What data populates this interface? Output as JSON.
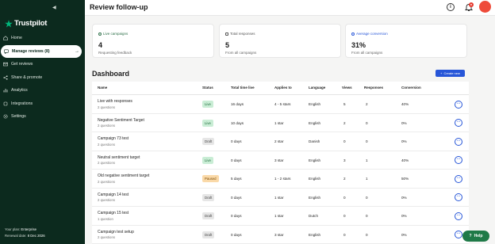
{
  "brand": {
    "name": "Trustpilot"
  },
  "sidebar": {
    "items": [
      {
        "label": "Home",
        "icon": "home-icon"
      },
      {
        "label": "Manage reviews (8)",
        "icon": "message-icon",
        "active": true
      },
      {
        "label": "Get reviews",
        "icon": "mail-icon"
      },
      {
        "label": "Share & promote",
        "icon": "share-icon"
      },
      {
        "label": "Analytics",
        "icon": "chart-icon"
      },
      {
        "label": "Integrations",
        "icon": "plug-icon"
      },
      {
        "label": "Settings",
        "icon": "gear-icon"
      }
    ],
    "footer": {
      "plan_label": "Your plan:",
      "plan_value": "Enterprise",
      "renewal_label": "Renewal date:",
      "renewal_value": "8 Dec 2026"
    }
  },
  "header": {
    "title": "Review follow-up"
  },
  "stats": [
    {
      "label": "Live campaigns",
      "value": "4",
      "sub": "Requesting feedback"
    },
    {
      "label": "Total responses",
      "value": "5",
      "sub": "From all campaigns"
    },
    {
      "label": "Average conversion",
      "value": "31%",
      "sub": "From all campaigns"
    }
  ],
  "dashboard": {
    "title": "Dashboard",
    "create_label": "Create new",
    "columns": [
      "Name",
      "Status",
      "Total time live",
      "Applies to",
      "Language",
      "Views",
      "Responses",
      "Conversion"
    ],
    "rows": [
      {
        "name": "Live with responses",
        "sub": "2 questions",
        "status": "Live",
        "time": "16 days",
        "applies": "4 - 5 stars",
        "language": "English",
        "views": "5",
        "responses": "2",
        "conversion": "40%"
      },
      {
        "name": "Negative Sentiment Target",
        "sub": "2 questions",
        "status": "Live",
        "time": "10 days",
        "applies": "1 star",
        "language": "English",
        "views": "2",
        "responses": "0",
        "conversion": "0%"
      },
      {
        "name": "Campaign 73 test",
        "sub": "2 questions",
        "status": "Draft",
        "time": "0 days",
        "applies": "2 star",
        "language": "Danish",
        "views": "0",
        "responses": "0",
        "conversion": "0%"
      },
      {
        "name": "Neutral sentiment target",
        "sub": "2 questions",
        "status": "Live",
        "time": "0 days",
        "applies": "3 star",
        "language": "English",
        "views": "3",
        "responses": "1",
        "conversion": "40%"
      },
      {
        "name": "Old negative sentiment target",
        "sub": "2 questions",
        "status": "Paused",
        "time": "5 days",
        "applies": "1 - 2 stars",
        "language": "English",
        "views": "2",
        "responses": "1",
        "conversion": "50%"
      },
      {
        "name": "Campaign 14 test",
        "sub": "2 questions",
        "status": "Draft",
        "time": "0 days",
        "applies": "1 star",
        "language": "English",
        "views": "0",
        "responses": "0",
        "conversion": "0%"
      },
      {
        "name": "Campaign 15 test",
        "sub": "1 question",
        "status": "Draft",
        "time": "0 days",
        "applies": "1 star",
        "language": "Dutch",
        "views": "0",
        "responses": "0",
        "conversion": "0%"
      },
      {
        "name": "Campaign test setup",
        "sub": "2 questions",
        "status": "Draft",
        "time": "0 days",
        "applies": "3 star",
        "language": "English",
        "views": "0",
        "responses": "0",
        "conversion": "0%"
      }
    ]
  },
  "help_label": "Help",
  "colors": {
    "sidebar": "#0c2a1e",
    "accent": "#2756d8",
    "live": "#c9edd5",
    "paused": "#fad9a8",
    "help": "#1f7a48"
  }
}
